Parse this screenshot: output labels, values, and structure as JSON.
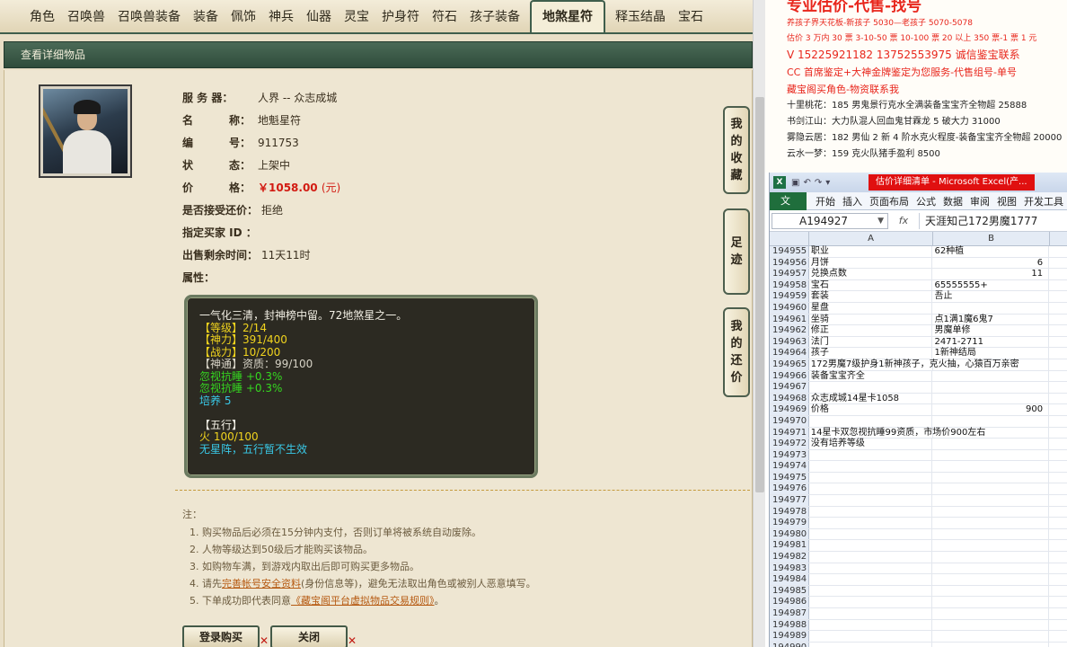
{
  "tabs": [
    {
      "label": "角色"
    },
    {
      "label": "召唤兽"
    },
    {
      "label": "召唤兽装备"
    },
    {
      "label": "装备"
    },
    {
      "label": "佩饰"
    },
    {
      "label": "神兵"
    },
    {
      "label": "仙器"
    },
    {
      "label": "灵宝"
    },
    {
      "label": "护身符"
    },
    {
      "label": "符石"
    },
    {
      "label": "孩子装备"
    },
    {
      "label": "地煞星符",
      "active": true
    },
    {
      "label": "释玉结晶"
    },
    {
      "label": "宝石"
    }
  ],
  "panel_title": "查看详细物品",
  "item": {
    "server_label": "服 务 器：",
    "server": "人界 -- 众志成城",
    "name_k1": "名",
    "name_k2": "称：",
    "name": "地魁星符",
    "id_k1": "编",
    "id_k2": "号：",
    "id": "911753",
    "state_k1": "状",
    "state_k2": "态：",
    "state": "上架中",
    "price_k1": "价",
    "price_k2": "格：",
    "price": "￥1058.00",
    "price_unit": "(元)",
    "bargain_label": "是否接受还价：",
    "bargain": "拒绝",
    "buyer_label": "指定买家 ID ：",
    "buyer": "",
    "remain_label": "出售剩余时间：",
    "remain": "11天11时",
    "attr_label": "属性："
  },
  "attributes": [
    {
      "text": "一气化三清，封神榜中留。72地煞星之一。",
      "color": "white"
    },
    {
      "text": "【等级】2/14",
      "color": "yellow"
    },
    {
      "text": "【神力】391/400",
      "color": "yellow"
    },
    {
      "text": "【战力】10/200",
      "color": "yellow"
    },
    {
      "text": "【神通】资质：99/100",
      "color": "gray"
    },
    {
      "text": "忽视抗睡 +0.3%",
      "color": "green"
    },
    {
      "text": "忽视抗睡 +0.3%",
      "color": "green"
    },
    {
      "text": "培养 5",
      "color": "cyan"
    },
    {
      "text": "",
      "color": "white"
    },
    {
      "text": "【五行】",
      "color": "white"
    },
    {
      "text": "火 100/100",
      "color": "yellow"
    },
    {
      "text": "无星阵，五行暂不生效",
      "color": "cyan"
    }
  ],
  "notes": {
    "title": "注：",
    "n1": "1. 购买物品后必须在15分钟内支付，否则订单将被系统自动废除。",
    "n2": "2. 人物等级达到50级后才能购买该物品。",
    "n3": "3. 如购物车满，到游戏内取出后即可购买更多物品。",
    "n4_pre": "4. 请先",
    "n4_link": "完善帐号安全资料",
    "n4_post": "(身份信息等)，避免无法取出角色或被别人恶意填写。",
    "n5_pre": "5. 下单成功即代表同意",
    "n5_link": "《藏宝阁平台虚拟物品交易规则》",
    "n5_post": "。"
  },
  "buttons": {
    "buy": "登录购买",
    "close": "关闭",
    "x": "✕"
  },
  "side_buttons": {
    "fav": [
      "我",
      "的",
      "收",
      "藏"
    ],
    "foot": [
      "足",
      "迹"
    ],
    "bargain": [
      "我",
      "的",
      "还",
      "价"
    ]
  },
  "notice": {
    "big": "专业估价-代售-找号",
    "l1": "养孩子界天花板-新孩子 5030—老孩子 5070-5078",
    "l2": "估价 3 万内 30 票 3-10-50 票 10-100 票 20 以上 350 票-1 票 1 元",
    "l3": "V 15225921182    13752553975  诚信鉴宝联系",
    "l4": "CC 首席鉴定+大神金牌鉴定为您服务-代售组号-单号",
    "l5": "藏宝阁买角色-物资联系我",
    "l6": "十里桃花：185 男鬼景行克水全满装备宝宝齐全物超 25888",
    "l7": "书剑江山：大力队混人回血鬼甘霖龙 5 破大力 31000",
    "l8": "雾隐云居：182 男仙 2 新 4 阶水克火程度-装备宝宝齐全物超 20000",
    "l9": "云水一梦：159 克火队猪手盈利 8500"
  },
  "excel": {
    "logo": "X",
    "title": "估价详细清单 - Microsoft Excel(产...",
    "ribbon": [
      "开始",
      "插入",
      "页面布局",
      "公式",
      "数据",
      "审阅",
      "视图",
      "开发工具"
    ],
    "file_tab": "文件",
    "namebox": "A194927",
    "fx": "fx",
    "formula": "天涯知己172男魔1777",
    "col_a": "A",
    "col_b": "B",
    "rows": [
      {
        "n": "194955",
        "a": "职业",
        "b": "62种植"
      },
      {
        "n": "194956",
        "a": "月饼",
        "b": "6",
        "num": true
      },
      {
        "n": "194957",
        "a": "兑换点数",
        "b": "11",
        "num": true
      },
      {
        "n": "194958",
        "a": "宝石",
        "b": "65555555+"
      },
      {
        "n": "194959",
        "a": "套装",
        "b": "吾止"
      },
      {
        "n": "194960",
        "a": "星盘",
        "b": ""
      },
      {
        "n": "194961",
        "a": "坐骑",
        "b": "点1满1魔6鬼7"
      },
      {
        "n": "194962",
        "a": "修正",
        "b": "男魔单修"
      },
      {
        "n": "194963",
        "a": "法门",
        "b": "2471-2711"
      },
      {
        "n": "194964",
        "a": "孩子",
        "b": "1新神结局"
      },
      {
        "n": "194965",
        "a": "172男魔7级护身1新神孩子，克火抽，心猿百万亲密",
        "b": ""
      },
      {
        "n": "194966",
        "a": "装备宝宝齐全",
        "b": ""
      },
      {
        "n": "194967",
        "a": "",
        "b": ""
      },
      {
        "n": "194968",
        "a": "众志成城14星卡1058",
        "b": ""
      },
      {
        "n": "194969",
        "a": "价格",
        "b": "900",
        "num": true
      },
      {
        "n": "194970",
        "a": "",
        "b": ""
      },
      {
        "n": "194971",
        "a": "14星卡双忽视抗睡99资质，市场价900左右",
        "b": ""
      },
      {
        "n": "194972",
        "a": "没有培养等级",
        "b": ""
      },
      {
        "n": "194973",
        "a": "",
        "b": ""
      },
      {
        "n": "194974",
        "a": "",
        "b": ""
      },
      {
        "n": "194975",
        "a": "",
        "b": ""
      },
      {
        "n": "194976",
        "a": "",
        "b": ""
      },
      {
        "n": "194977",
        "a": "",
        "b": ""
      },
      {
        "n": "194978",
        "a": "",
        "b": ""
      },
      {
        "n": "194979",
        "a": "",
        "b": ""
      },
      {
        "n": "194980",
        "a": "",
        "b": ""
      },
      {
        "n": "194981",
        "a": "",
        "b": ""
      },
      {
        "n": "194982",
        "a": "",
        "b": ""
      },
      {
        "n": "194983",
        "a": "",
        "b": ""
      },
      {
        "n": "194984",
        "a": "",
        "b": ""
      },
      {
        "n": "194985",
        "a": "",
        "b": ""
      },
      {
        "n": "194986",
        "a": "",
        "b": ""
      },
      {
        "n": "194987",
        "a": "",
        "b": ""
      },
      {
        "n": "194988",
        "a": "",
        "b": ""
      },
      {
        "n": "194989",
        "a": "",
        "b": ""
      },
      {
        "n": "194990",
        "a": "",
        "b": ""
      }
    ]
  }
}
